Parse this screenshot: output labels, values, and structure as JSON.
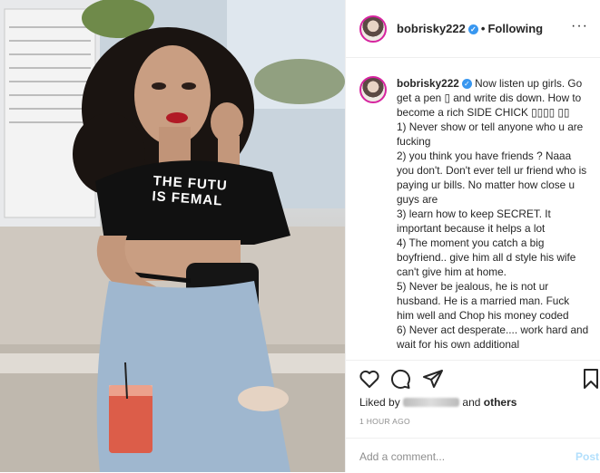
{
  "post": {
    "username": "bobrisky222",
    "follow_separator": "•",
    "follow_status": "Following",
    "more_icon": "more-dots-icon",
    "shirt_text": [
      "THE FUTU",
      "IS FEMAL"
    ]
  },
  "caption": {
    "username": "bobrisky222",
    "lines": [
      "Now listen up girls. Go get a pen ▯ and write dis down. How to become a rich SIDE CHICK ▯▯▯▯ ▯▯",
      "1) Never show or tell anyone who u are fucking",
      "2) you think you have friends ? Naaa you don't. Don't ever tell ur friend who is paying ur bills. No matter how close u guys are",
      "3) learn how to keep SECRET. It important because it helps a lot",
      "4) The moment you catch a big boyfriend.. give him all d style his wife can't give him at home.",
      "5) Never be jealous, he is not ur husband. He is a married man. Fuck him well and Chop his money coded",
      "6) Never act desperate.... work hard and wait for his own additional"
    ]
  },
  "actions": {
    "like_icon": "heart-icon",
    "comment_icon": "comment-icon",
    "save_icon": "bookmark-icon"
  },
  "likes": {
    "prefix": "Liked by",
    "suffix_and": "and",
    "suffix_others": "others"
  },
  "time_ago": "1 HOUR AGO",
  "comment_box": {
    "placeholder": "Add a comment...",
    "post_label": "Post"
  },
  "colors": {
    "link_blue": "#3897f0",
    "post_disabled": "#b2dffc",
    "muted": "#8e8e8e",
    "avatar_ring": "#d6249f"
  }
}
